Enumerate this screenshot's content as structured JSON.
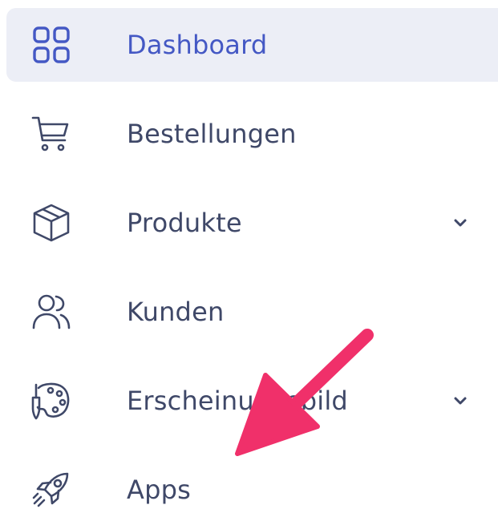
{
  "sidebar": {
    "items": [
      {
        "label": "Dashboard",
        "icon": "dashboard-grid-icon",
        "active": true
      },
      {
        "label": "Bestellungen",
        "icon": "shopping-cart-icon",
        "active": false
      },
      {
        "label": "Produkte",
        "icon": "product-box-icon",
        "active": false,
        "expandable": true
      },
      {
        "label": "Kunden",
        "icon": "customers-icon",
        "active": false
      },
      {
        "label": "Erscheinungsbild",
        "icon": "palette-icon",
        "active": false,
        "expandable": true
      },
      {
        "label": "Apps",
        "icon": "rocket-icon",
        "active": false
      }
    ]
  },
  "colors": {
    "active_background": "#eceef6",
    "active_text": "#4458c4",
    "text": "#3f4868",
    "annotation_arrow": "#f0306a"
  },
  "annotation": {
    "icon": "pointer-arrow-icon",
    "target": "Apps"
  }
}
